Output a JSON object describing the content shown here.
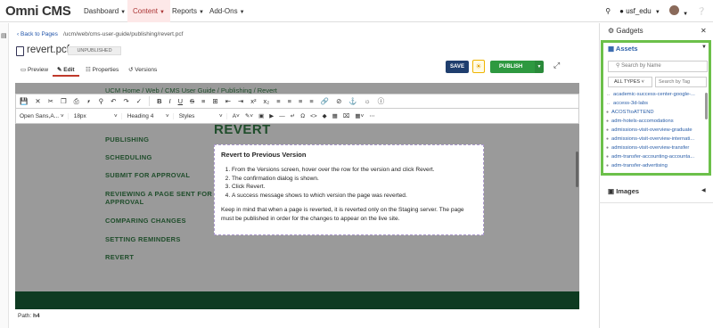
{
  "app": {
    "logo": "Omni CMS"
  },
  "nav": [
    {
      "label": "Dashboard",
      "active": false
    },
    {
      "label": "Content",
      "active": true
    },
    {
      "label": "Reports",
      "active": false
    },
    {
      "label": "Add-Ons",
      "active": false
    }
  ],
  "account": {
    "site": "usf_edu"
  },
  "header": {
    "back_label": "Back to Pages",
    "path": "/ucm/web/cms-user-guide/publishing/revert.pcf",
    "file_name": "revert.pcf",
    "status": "UNPUBLISHED"
  },
  "tabs": {
    "preview": "Preview",
    "edit": "Edit",
    "properties": "Properties",
    "versions": "Versions"
  },
  "actions": {
    "save": "SAVE",
    "publish": "PUBLISH"
  },
  "toolbar": {
    "font": "Open Sans,A...",
    "size": "18px",
    "block": "Heading 4",
    "styles": "Styles"
  },
  "page": {
    "breadcrumb": "UCM Home / Web / CMS User Guide / Publishing / Revert",
    "heading": "REVERT",
    "sidebar": [
      "PUBLISHING",
      "SCHEDULING",
      "SUBMIT FOR APPROVAL",
      "REVIEWING A PAGE SENT FOR",
      "APPROVAL",
      "COMPARING CHANGES",
      "SETTING REMINDERS",
      "REVERT"
    ],
    "content_title": "Revert to Previous Version",
    "steps": [
      "From the Versions screen, hover over the row for the version and click Revert.",
      "The confirmation dialog is shown.",
      "Click Revert.",
      "A success message shows to which version the page was reverted."
    ],
    "note": "Keep in mind that when a page is reverted, it is reverted only on the Staging server. The page must be published in order for the changes to appear on the live site."
  },
  "path_bar": {
    "label": "Path:",
    "value": "h4"
  },
  "gadgets": {
    "title": "Gadgets",
    "assets_title": "Assets",
    "search_placeholder": "Search by Name",
    "types_label": "ALL TYPES",
    "tag_placeholder": "Search by Tag",
    "assets": [
      "academic-success-center-google-...",
      "access-3d-labs",
      "ACOSTtoATTEND",
      "adm-hotels-accomodations",
      "admissions-visit-overview-graduate",
      "admissions-visit-overview-internati...",
      "admissions-visit-overview-transfer",
      "adm-transfer-accounting-accounta...",
      "adm-transfer-advertising"
    ],
    "images_title": "Images"
  }
}
